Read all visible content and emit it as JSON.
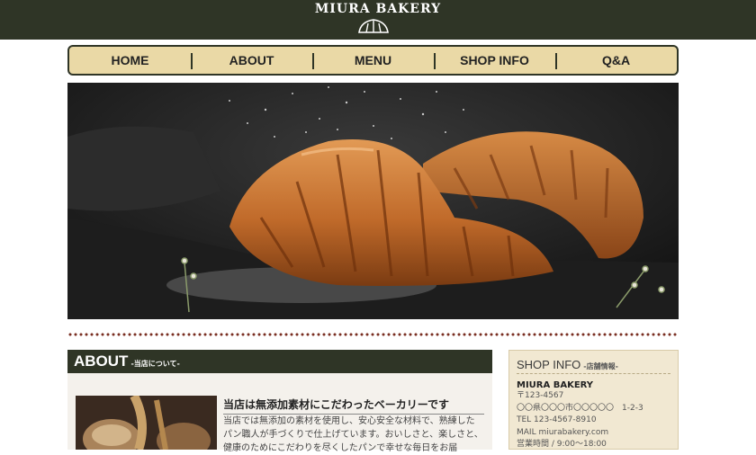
{
  "header": {
    "brand": "MIURA BAKERY",
    "logo_icon": "croissant-icon"
  },
  "nav": {
    "items": [
      "HOME",
      "ABOUT",
      "MENU",
      "SHOP INFO",
      "Q&A"
    ]
  },
  "hero": {
    "image": "croissant-photo"
  },
  "about": {
    "title": "ABOUT",
    "subtitle": "-当店について-",
    "heading": "当店は無添加素材にこだわったベーカリーです",
    "text": "当店では無添加の素材を使用し、安心安全な材料で、熟練したパン職人が手づくりで仕上げています。おいしさと、楽しさと、健康のためにこだわりを尽くしたパンで幸せな毎日をお届"
  },
  "shop": {
    "title": "SHOP INFO",
    "subtitle": "-店舗情報-",
    "name": "MIURA BAKERY",
    "postal": "〒123-4567",
    "address": "〇〇県〇〇〇市〇〇〇〇〇　1-2-3",
    "tel": "TEL 123-4567-8910",
    "mail": "MAIL miurabakery.com",
    "hours": "営業時間 / 9:00～18:00"
  },
  "colors": {
    "header_bg": "#2f3526",
    "nav_bg": "#ead9a6",
    "dot_line": "#7a2f22",
    "shop_bg": "#f1e8d2"
  }
}
